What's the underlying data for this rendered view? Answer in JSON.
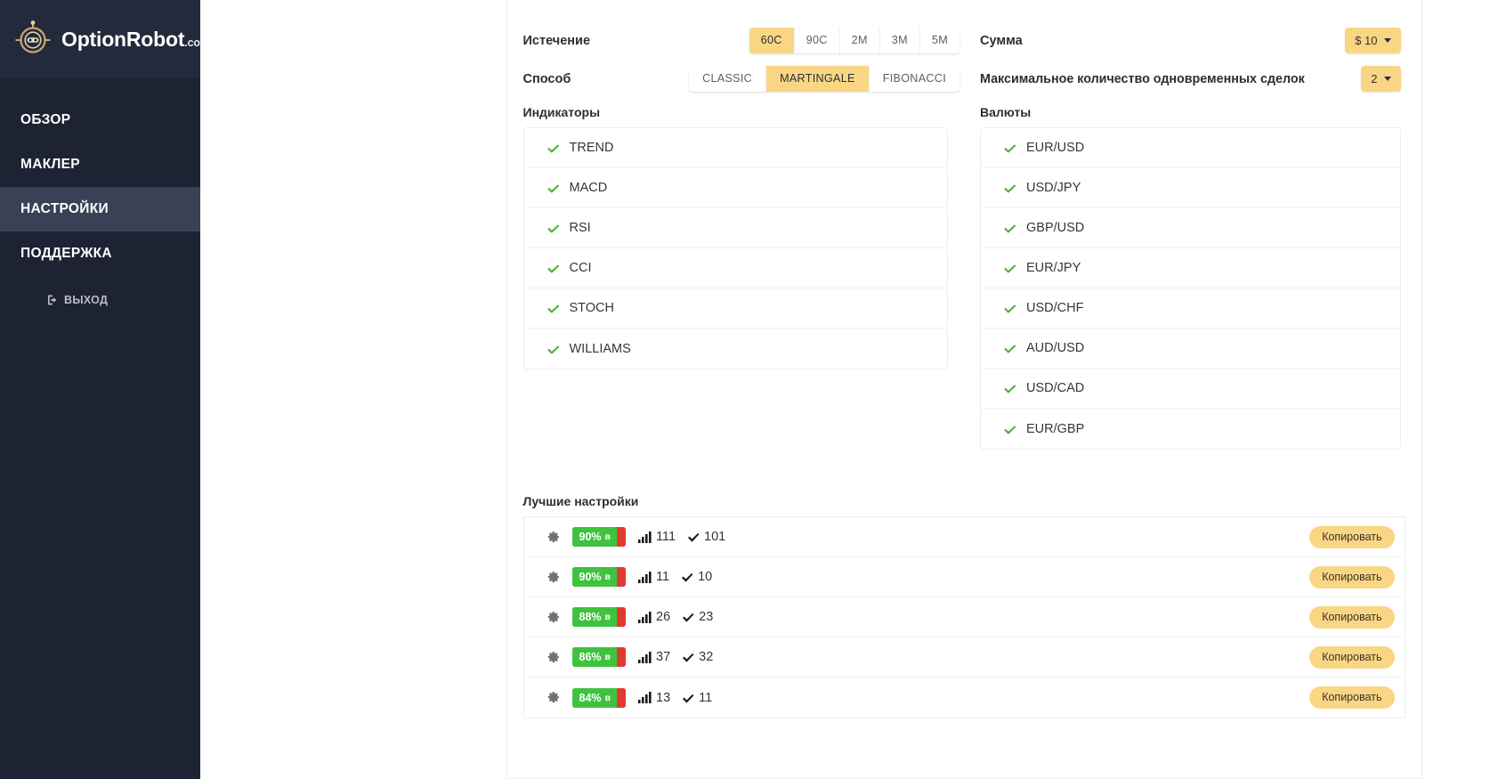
{
  "brand": {
    "name": "OptionRobot",
    "suffix": ".com",
    "logo_icon": "robot-head-icon"
  },
  "sidebar": {
    "items": [
      {
        "label": "ОБЗОР",
        "active": false
      },
      {
        "label": "МАКЛЕР",
        "active": false
      },
      {
        "label": "НАСТРОЙКИ",
        "active": true
      },
      {
        "label": "ПОДДЕРЖКА",
        "active": false
      }
    ],
    "logout": {
      "label": "ВЫХОД",
      "icon": "logout-icon"
    }
  },
  "settings": {
    "expiration": {
      "label": "Истечение",
      "options": [
        "60C",
        "90C",
        "2M",
        "3M",
        "5M"
      ],
      "selected": "60C"
    },
    "method": {
      "label": "Способ",
      "options": [
        "CLASSIC",
        "MARTINGALE",
        "FIBONACCI"
      ],
      "selected": "MARTINGALE"
    },
    "amount": {
      "label": "Сумма",
      "value": "$ 10"
    },
    "max_trades": {
      "label": "Максимальное количество одновременных сделок",
      "value": "2"
    }
  },
  "indicators": {
    "title": "Индикаторы",
    "items": [
      {
        "label": "TREND",
        "enabled": true
      },
      {
        "label": "MACD",
        "enabled": true
      },
      {
        "label": "RSI",
        "enabled": true
      },
      {
        "label": "CCI",
        "enabled": true
      },
      {
        "label": "STOCH",
        "enabled": true
      },
      {
        "label": "WILLIAMS",
        "enabled": true
      }
    ]
  },
  "currencies": {
    "title": "Валюты",
    "items": [
      {
        "label": "EUR/USD",
        "enabled": true
      },
      {
        "label": "USD/JPY",
        "enabled": true
      },
      {
        "label": "GBP/USD",
        "enabled": true
      },
      {
        "label": "EUR/JPY",
        "enabled": true
      },
      {
        "label": "USD/CHF",
        "enabled": true
      },
      {
        "label": "AUD/USD",
        "enabled": true
      },
      {
        "label": "USD/CAD",
        "enabled": true
      },
      {
        "label": "EUR/GBP",
        "enabled": true
      }
    ]
  },
  "best_settings": {
    "title": "Лучшие настройки",
    "copy_label": "Копировать",
    "rows": [
      {
        "percent": "90%",
        "percent_suffix": "в",
        "percent_value": 90,
        "trades": "111",
        "wins": "101"
      },
      {
        "percent": "90%",
        "percent_suffix": "в",
        "percent_value": 90,
        "trades": "11",
        "wins": "10"
      },
      {
        "percent": "88%",
        "percent_suffix": "в",
        "percent_value": 88,
        "trades": "26",
        "wins": "23"
      },
      {
        "percent": "86%",
        "percent_suffix": "в",
        "percent_value": 86,
        "trades": "37",
        "wins": "32"
      },
      {
        "percent": "84%",
        "percent_suffix": "в",
        "percent_value": 84,
        "trades": "13",
        "wins": "11"
      }
    ]
  },
  "colors": {
    "sidebar_bg": "#1d2333",
    "sidebar_active": "#394155",
    "accent_yellow": "#f9d684",
    "green": "#3fc23f",
    "red": "#e03a2f",
    "check_green": "#4caf34"
  }
}
